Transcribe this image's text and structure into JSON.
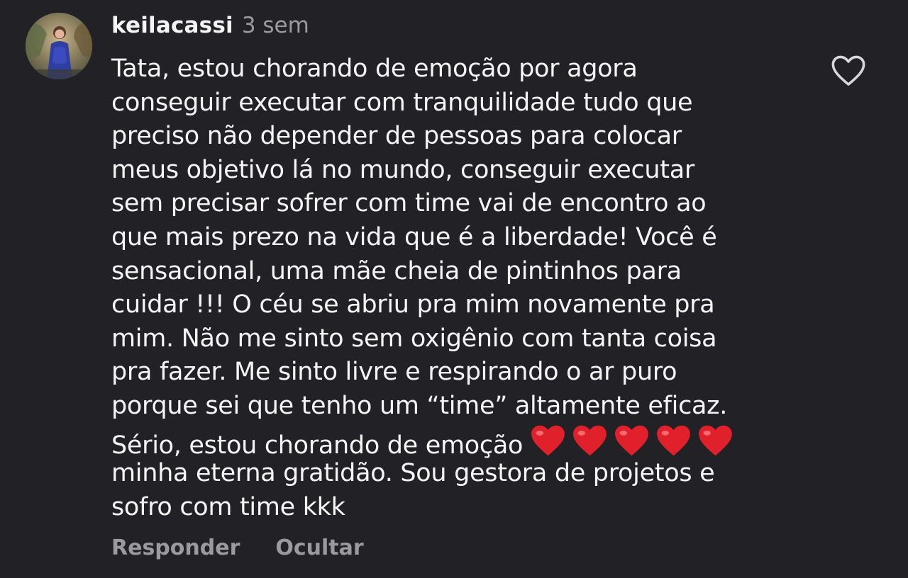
{
  "comment": {
    "username": "keilacassi",
    "timestamp": "3 sem",
    "avatar_icon": "profile-photo",
    "like_icon": "heart-outline-icon",
    "lines": [
      "Tata, estou chorando de emoção por agora",
      "conseguir executar com tranquilidade tudo que",
      "preciso não depender de pessoas para colocar",
      "meus objetivo lá no mundo, conseguir executar",
      "sem precisar sofrer com time vai de encontro ao",
      "que mais prezo na vida que é a liberdade! Você é",
      "sensacional, uma mãe cheia de pintinhos para",
      "cuidar !!! O céu se abriu pra mim novamente pra",
      "mim. Não me sinto sem oxigênio com tanta coisa",
      "pra fazer. Me sinto livre e respirando o ar puro",
      "porque sei que tenho um “time” altamente eficaz.",
      "Sério, estou chorando de emoção",
      "minha eterna gratidão. Sou gestora de projetos e",
      "sofro com time kkk"
    ],
    "emoji": "❤️❤️❤️❤️❤️",
    "emoji_color": "#e0202a",
    "actions": {
      "reply": "Responder",
      "hide": "Ocultar"
    }
  },
  "colors": {
    "background": "#222226",
    "text": "#f5f5f5",
    "muted": "#9a9aa0"
  }
}
